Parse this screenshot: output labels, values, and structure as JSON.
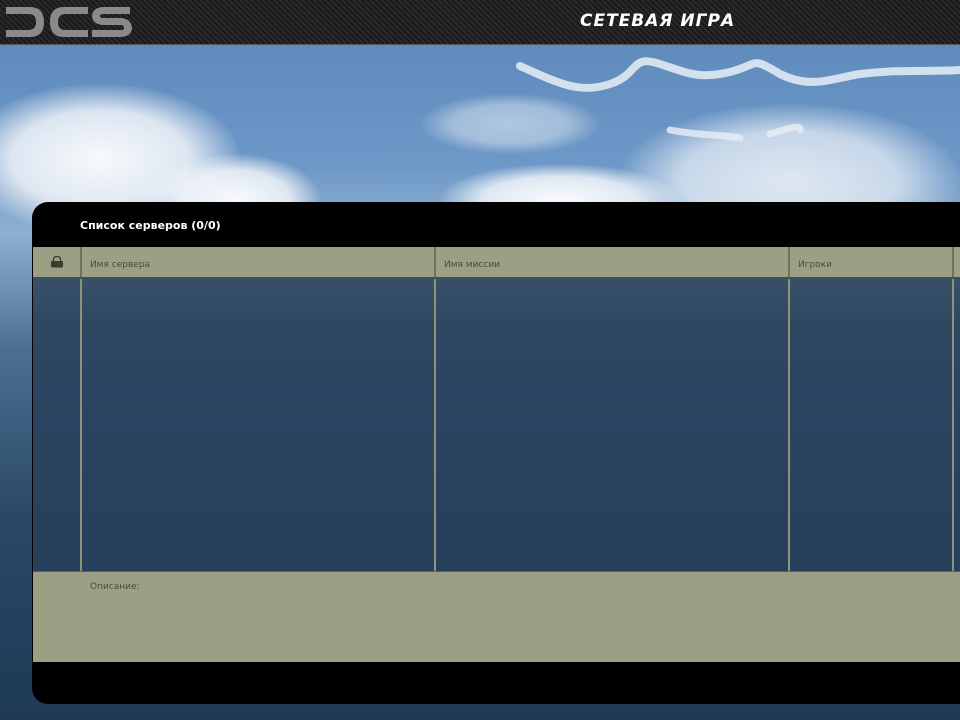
{
  "header": {
    "logo_text": "DCS",
    "title": "СЕТЕВАЯ ИГРА"
  },
  "server_list": {
    "title": "Список серверов (0/0)",
    "columns": [
      {
        "key": "lock",
        "label": ""
      },
      {
        "key": "server_name",
        "label": "Имя сервера"
      },
      {
        "key": "mission_name",
        "label": "Имя миссии"
      },
      {
        "key": "players",
        "label": "Игроки"
      }
    ],
    "rows": []
  },
  "description": {
    "label": "Описание:"
  },
  "icons": {
    "lock": "lock-icon"
  },
  "colors": {
    "header_bg": "#9c9f84",
    "panel_bg": "#000000",
    "table_bg": "#2a4461"
  }
}
